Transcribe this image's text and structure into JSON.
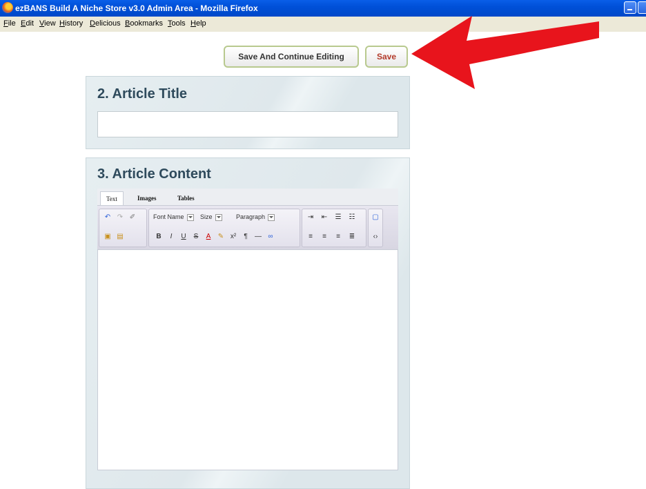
{
  "window": {
    "title": "ezBANS Build A Niche Store v3.0 Admin Area - Mozilla Firefox"
  },
  "menubar": {
    "items": [
      "File",
      "Edit",
      "View",
      "History",
      "Delicious",
      "Bookmarks",
      "Tools",
      "Help"
    ]
  },
  "actions": {
    "save_continue_label": "Save And Continue Editing",
    "save_label": "Save"
  },
  "article_title_section": {
    "heading": "2. Article Title",
    "value": ""
  },
  "article_content_section": {
    "heading": "3. Article Content",
    "tabs": [
      "Text",
      "Images",
      "Tables"
    ],
    "toolbar": {
      "font_name": "Font Name",
      "size": "Size",
      "paragraph": "Paragraph"
    }
  },
  "colors": {
    "titlebar": "#0050d8",
    "arrow": "#e8141c",
    "save_text": "#b33a2a",
    "heading": "#2e4a5c"
  }
}
